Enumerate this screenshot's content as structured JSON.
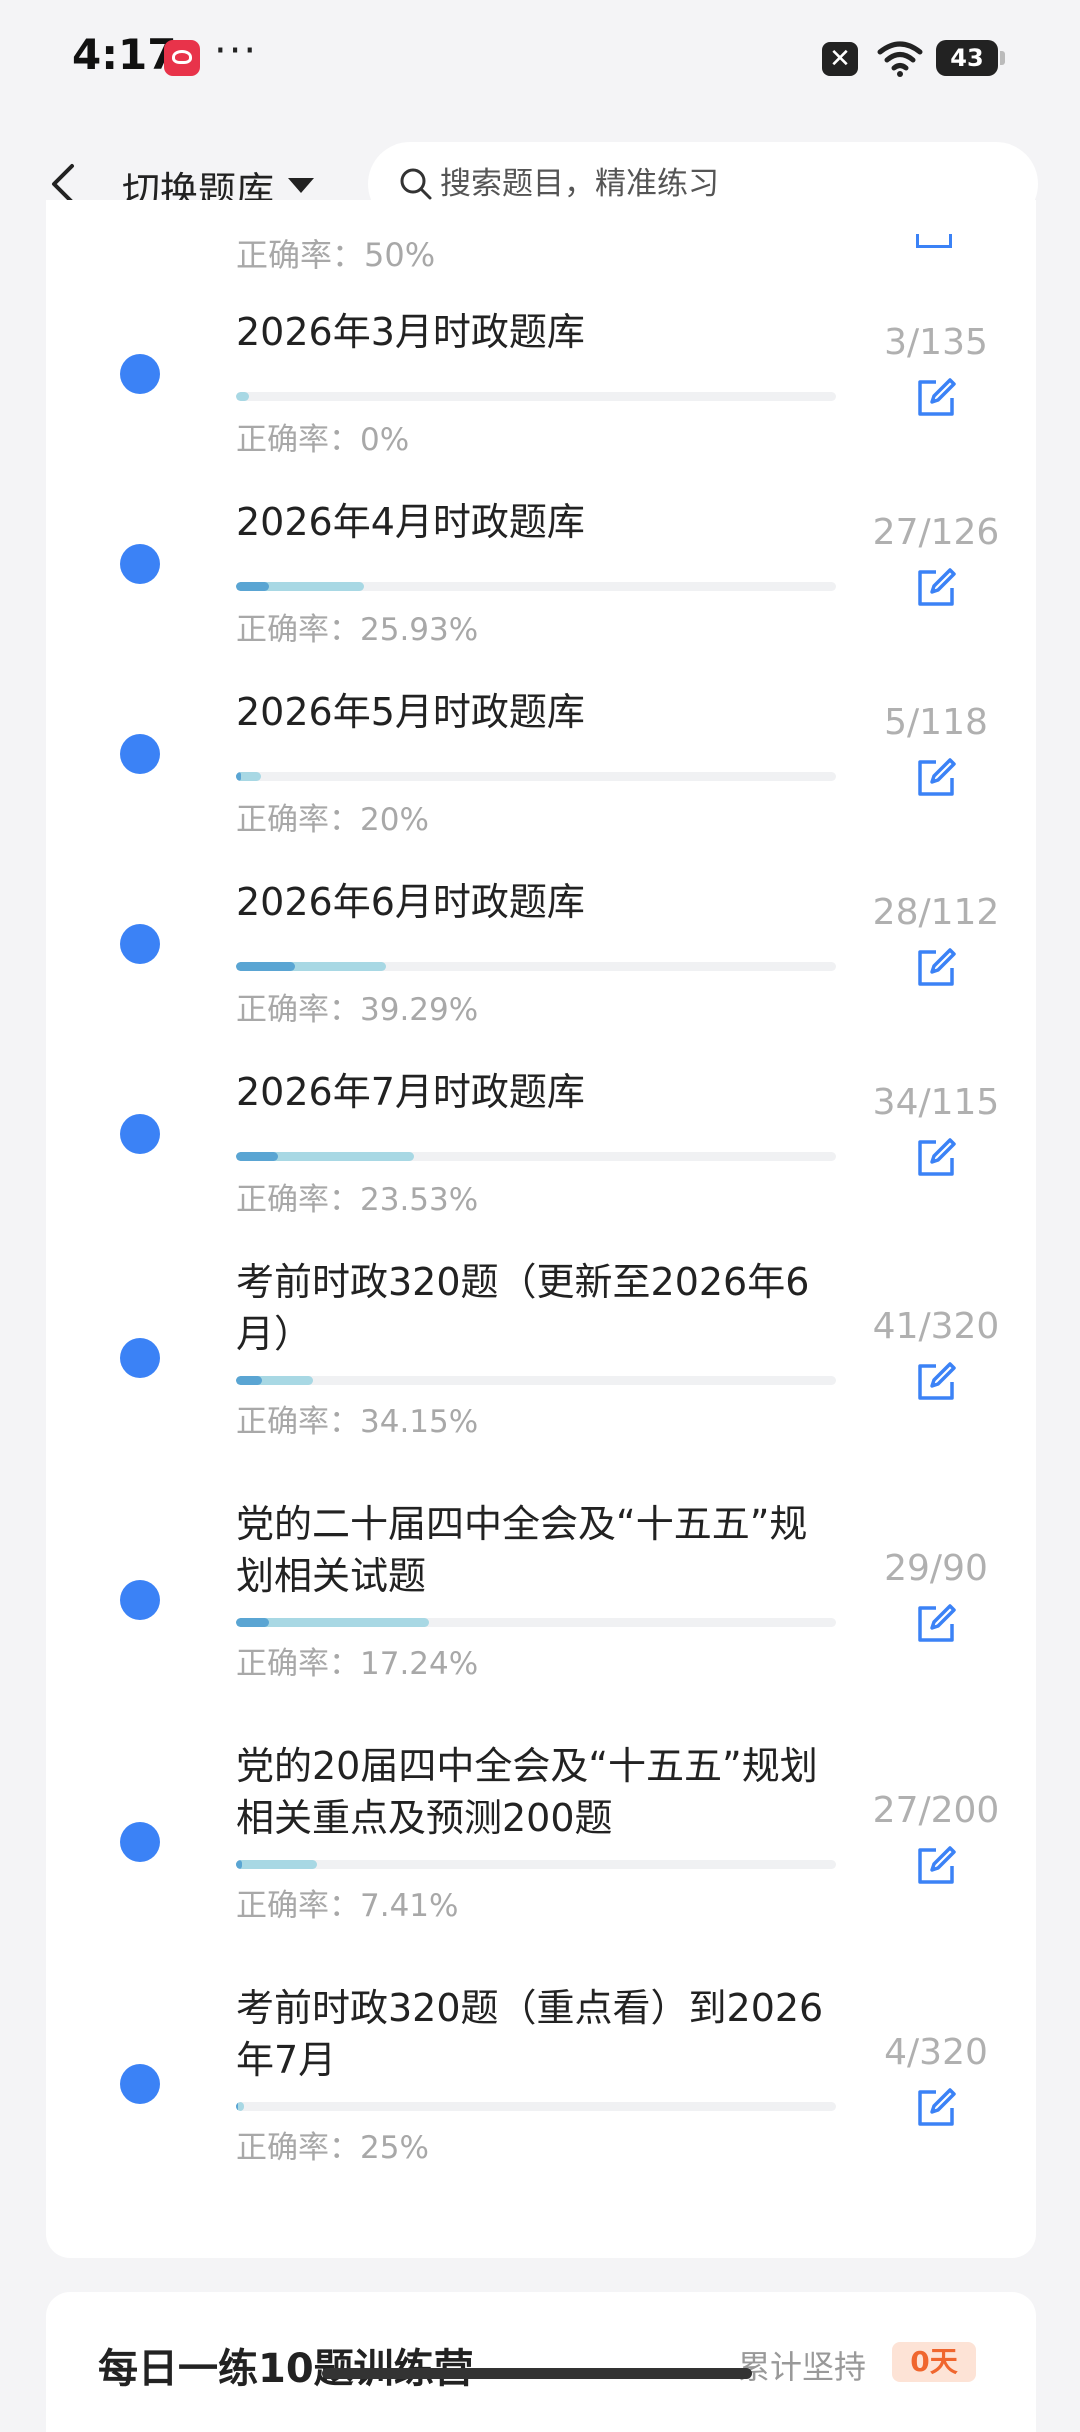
{
  "status_bar": {
    "time": "4:17",
    "dots": "···",
    "battery": "43"
  },
  "header": {
    "title": "切换题库",
    "search_placeholder": "搜索题目，精准练习"
  },
  "partial_top_accuracy": "正确率：50%",
  "items": [
    {
      "title": "2026年3月时政题库",
      "count": "3/135",
      "accuracy": "正确率：0%",
      "done_fraction": 0.022,
      "correct_fraction": 0.0
    },
    {
      "title": "2026年4月时政题库",
      "count": "27/126",
      "accuracy": "正确率：25.93%",
      "done_fraction": 0.214,
      "correct_fraction": 0.2593
    },
    {
      "title": "2026年5月时政题库",
      "count": "5/118",
      "accuracy": "正确率：20%",
      "done_fraction": 0.042,
      "correct_fraction": 0.2
    },
    {
      "title": "2026年6月时政题库",
      "count": "28/112",
      "accuracy": "正确率：39.29%",
      "done_fraction": 0.25,
      "correct_fraction": 0.3929
    },
    {
      "title": "2026年7月时政题库",
      "count": "34/115",
      "accuracy": "正确率：23.53%",
      "done_fraction": 0.296,
      "correct_fraction": 0.2353
    },
    {
      "title": "考前时政320题（更新至2026年6月）",
      "count": "41/320",
      "accuracy": "正确率：34.15%",
      "done_fraction": 0.128,
      "correct_fraction": 0.3415
    },
    {
      "title": "党的二十届四中全会及“十五五”规划相关试题",
      "count": "29/90",
      "accuracy": "正确率：17.24%",
      "done_fraction": 0.322,
      "correct_fraction": 0.1724
    },
    {
      "title": "党的20届四中全会及“十五五”规划相关重点及预测200题",
      "count": "27/200",
      "accuracy": "正确率：7.41%",
      "done_fraction": 0.135,
      "correct_fraction": 0.0741
    },
    {
      "title": "考前时政320题（重点看）到2026年7月",
      "count": "4/320",
      "accuracy": "正确率：25%",
      "done_fraction": 0.0125,
      "correct_fraction": 0.25
    }
  ],
  "next_card": {
    "title": "每日一练10题训练营",
    "right_text": "累计坚持",
    "badge": "0天"
  },
  "colors": {
    "dot": "#3b82f6",
    "progress_light": "#a8d8e4",
    "progress_dark": "#5aa5d3",
    "edit_icon": "#3b82f6"
  }
}
